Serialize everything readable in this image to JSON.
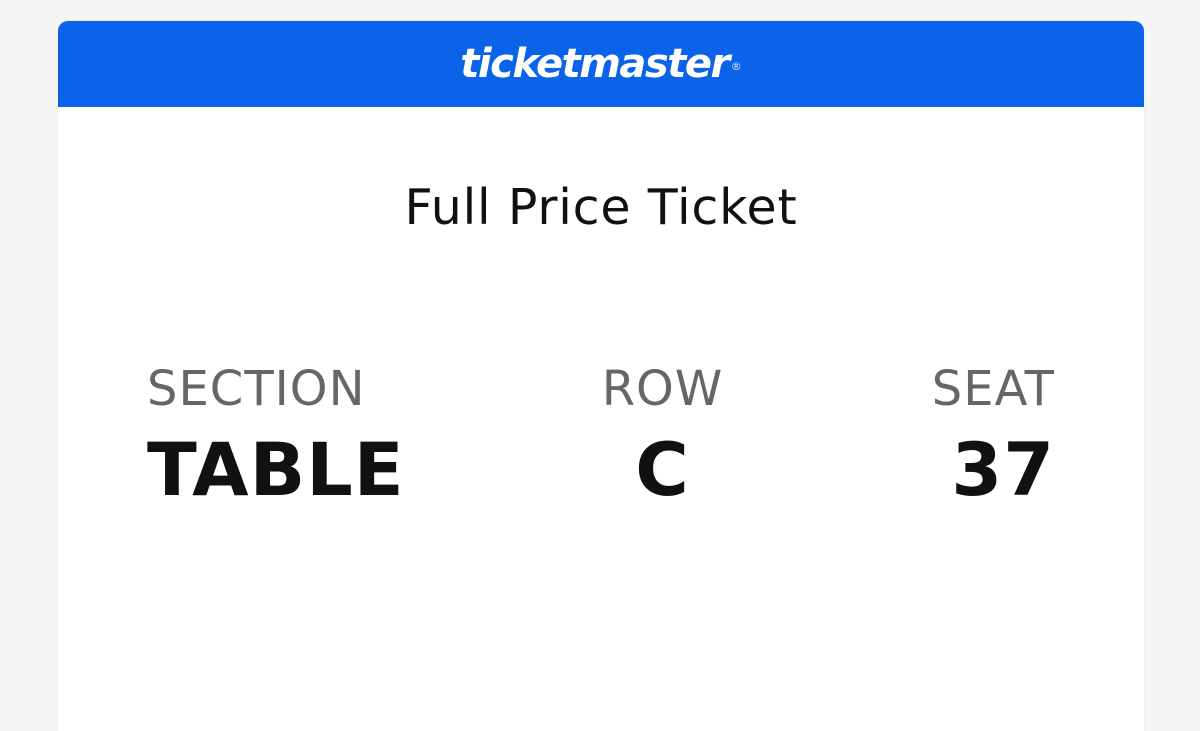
{
  "brand": {
    "name": "ticketmaster",
    "registered_mark": "®",
    "color": "#0A63E8"
  },
  "ticket": {
    "type": "Full Price Ticket",
    "section": {
      "label": "SECTION",
      "value": "TABLE"
    },
    "row": {
      "label": "ROW",
      "value": "C"
    },
    "seat": {
      "label": "SEAT",
      "value": "37"
    }
  },
  "colors": {
    "background": "#F5F5F5",
    "card": "#FFFFFF",
    "text_primary": "#111111",
    "text_secondary": "#666666"
  }
}
